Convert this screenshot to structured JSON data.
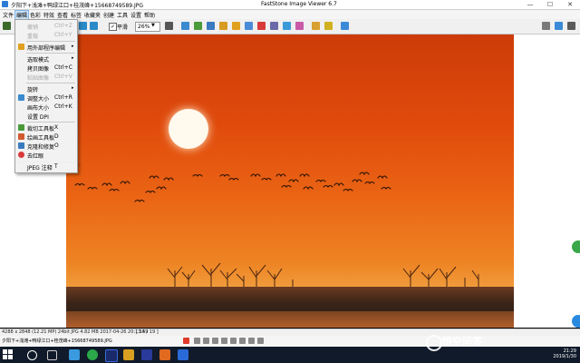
{
  "window": {
    "file_title": "夕阳下+浅滩+鸭绿江口+桂茂峰+15668749589.JPG",
    "app_title": "FastStone Image Viewer 6.7",
    "min": "—",
    "max": "☐",
    "close": "✕"
  },
  "menubar": [
    "文件",
    "编辑",
    "色彩",
    "特效",
    "查看",
    "标签",
    "收藏夹",
    "创建",
    "工具",
    "设置",
    "帮助"
  ],
  "toolbar": {
    "checkbox_label": "平滑",
    "checkbox_mark": "✓",
    "zoom": "26%",
    "zoom_arrow": "▼"
  },
  "edit_menu": {
    "items": [
      {
        "label": "撤销",
        "shortcut": "Ctrl+Z",
        "disabled": true
      },
      {
        "label": "重做",
        "shortcut": "Ctrl+Y",
        "disabled": true
      },
      {
        "label": "用外部程序编辑",
        "shortcut": "",
        "arrow": "▸"
      },
      {
        "label": "选取模式",
        "shortcut": "",
        "arrow": "▸"
      },
      {
        "label": "拷贝图像",
        "shortcut": "Ctrl+C"
      },
      {
        "label": "粘贴图像",
        "shortcut": "Ctrl+V",
        "disabled": true
      },
      {
        "label": "旋转",
        "shortcut": "",
        "arrow": "▸"
      },
      {
        "label": "调整大小",
        "shortcut": "Ctrl+R"
      },
      {
        "label": "画布大小",
        "shortcut": "Ctrl+K"
      },
      {
        "label": "设置 DPI",
        "shortcut": ""
      },
      {
        "label": "裁切工具板",
        "shortcut": "X"
      },
      {
        "label": "绘画工具板",
        "shortcut": "D"
      },
      {
        "label": "克隆和修复",
        "shortcut": "O"
      },
      {
        "label": "去红眼",
        "shortcut": ""
      },
      {
        "label": "JPEG 注释",
        "shortcut": "T"
      }
    ]
  },
  "status": {
    "info": "4288 x 2848 (12.21 MP)  24bit  JPG  4.82 MB  2017-04-26 20:13:59",
    "position": "[ 14 / 19 ]",
    "filename_bottom": "夕阳下+浅滩+鸭绿江口+桂茂峰+15668749589.JPG"
  },
  "clock": {
    "time": "21:29",
    "date": "2019/1/30"
  },
  "watermark": "悟空问答",
  "colors": {
    "accent": "#2b7bd6",
    "menu_highlight": "#cce4f7",
    "taskbar": "#101a2a"
  }
}
